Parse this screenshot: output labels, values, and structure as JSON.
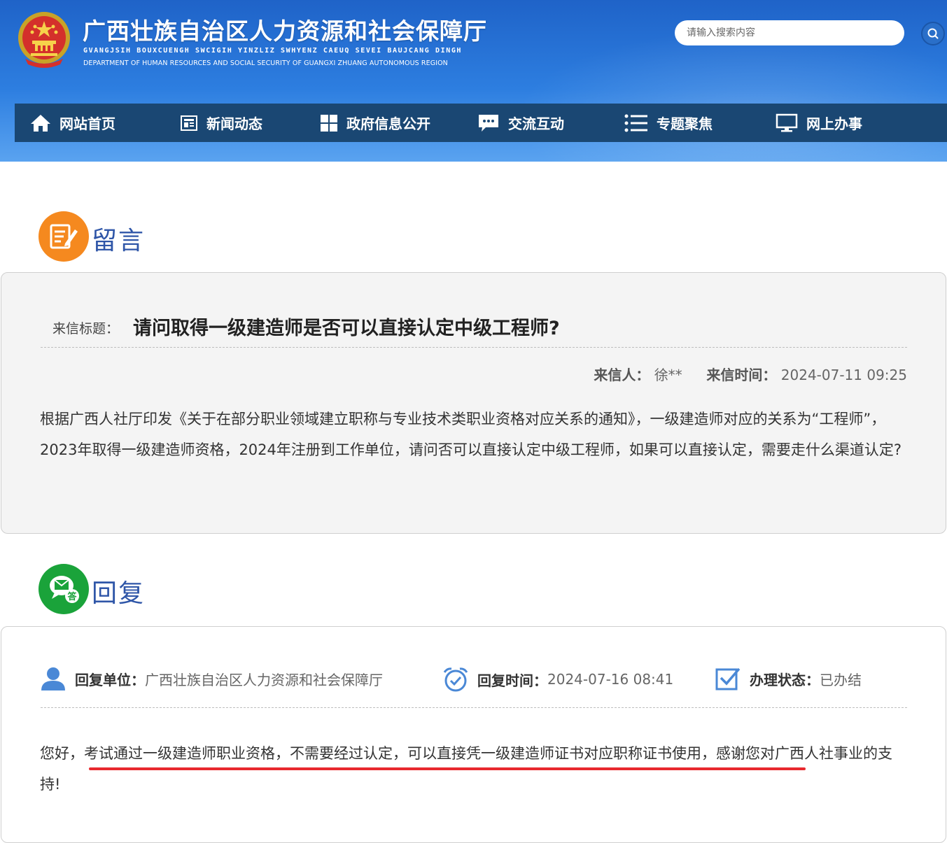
{
  "header": {
    "title_cn": "广西壮族自治区人力资源和社会保障厅",
    "title_zhuang": "GVANGJSIH BOUXCUENGH SWCIGIH YINZLIZ SWHYENZ CAEUQ SEVEI BAUJCANG DINGH",
    "title_en": "DEPARTMENT OF HUMAN RESOURCES AND SOCIAL SECURITY OF GUANGXI ZHUANG AUTONOMOUS REGION",
    "search_placeholder": "请输入搜索内容"
  },
  "nav": {
    "items": [
      {
        "label": "网站首页",
        "icon": "home-icon"
      },
      {
        "label": "新闻动态",
        "icon": "news-icon"
      },
      {
        "label": "政府信息公开",
        "icon": "grid-icon"
      },
      {
        "label": "交流互动",
        "icon": "chat-icon"
      },
      {
        "label": "专题聚焦",
        "icon": "list-icon"
      },
      {
        "label": "网上办事",
        "icon": "monitor-icon"
      }
    ]
  },
  "message": {
    "section_title": "留言",
    "title_label": "来信标题：",
    "title": "请问取得一级建造师是否可以直接认定中级工程师?",
    "sender_label": "来信人：",
    "sender": "徐**",
    "time_label": "来信时间：",
    "time": "2024-07-11 09:25",
    "body": "根据广西人社厅印发《关于在部分职业领域建立职称与专业技术类职业资格对应关系的通知》，一级建造师对应的关系为“工程师”，2023年取得一级建造师资格，2024年注册到工作单位，请问否可以直接认定中级工程师，如果可以直接认定，需要走什么渠道认定?"
  },
  "reply": {
    "section_title": "回复",
    "unit_label": "回复单位：",
    "unit": "广西壮族自治区人力资源和社会保障厅",
    "time_label": "回复时间：",
    "time": "2024-07-16 08:41",
    "status_label": "办理状态：",
    "status": "已办结",
    "body": "您好，考试通过一级建造师职业资格，不需要经过认定，可以直接凭一级建造师证书对应职称证书使用，感谢您对广西人社事业的支持!"
  },
  "colors": {
    "header_blue": "#2d7ee0",
    "nav_bg": "#1a4773",
    "section_title": "#2f56a8",
    "message_icon": "#f5891f",
    "reply_icon": "#1aa33a",
    "underline_red": "#e8292e"
  }
}
